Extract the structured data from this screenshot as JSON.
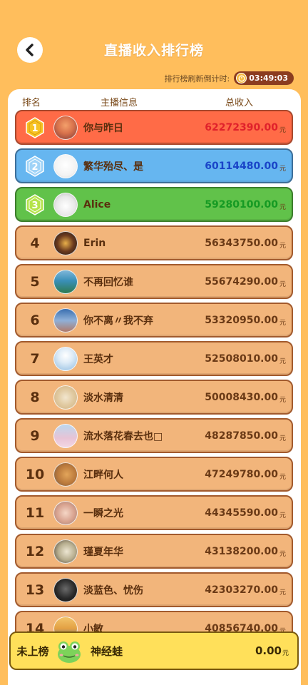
{
  "header": {
    "title": "直播收入排行榜",
    "countdown_label": "排行榜刷新倒计时:",
    "countdown_value": "03:49:03"
  },
  "columns": {
    "rank": "排名",
    "host": "主播信息",
    "total": "总收入"
  },
  "unit": "元",
  "rows": [
    {
      "rank": "1",
      "name": "你与昨日",
      "amount": "62272390.00"
    },
    {
      "rank": "2",
      "name": "繁华殆尽、是",
      "amount": "60114480.00"
    },
    {
      "rank": "3",
      "name": "Alice",
      "amount": "59280100.00"
    },
    {
      "rank": "4",
      "name": "Erin",
      "amount": "56343750.00"
    },
    {
      "rank": "5",
      "name": "不再回忆谁",
      "amount": "55674290.00"
    },
    {
      "rank": "6",
      "name": "你不离〃我不弃",
      "amount": "53320950.00"
    },
    {
      "rank": "7",
      "name": "王英才",
      "amount": "52508010.00"
    },
    {
      "rank": "8",
      "name": "淡水清清",
      "amount": "50008430.00"
    },
    {
      "rank": "9",
      "name": "流水落花春去也□",
      "amount": "48287850.00"
    },
    {
      "rank": "10",
      "name": "江畔何人",
      "amount": "47249780.00"
    },
    {
      "rank": "11",
      "name": "一瞬之光",
      "amount": "44345590.00"
    },
    {
      "rank": "12",
      "name": "瑾夏年华",
      "amount": "43138200.00"
    },
    {
      "rank": "13",
      "name": "淡蓝色、忧伤",
      "amount": "42303270.00"
    },
    {
      "rank": "14",
      "name": "小敏",
      "amount": "40856740.00"
    }
  ],
  "me": {
    "rank_label": "未上榜",
    "name": "神经蛙",
    "amount": "0.00"
  }
}
